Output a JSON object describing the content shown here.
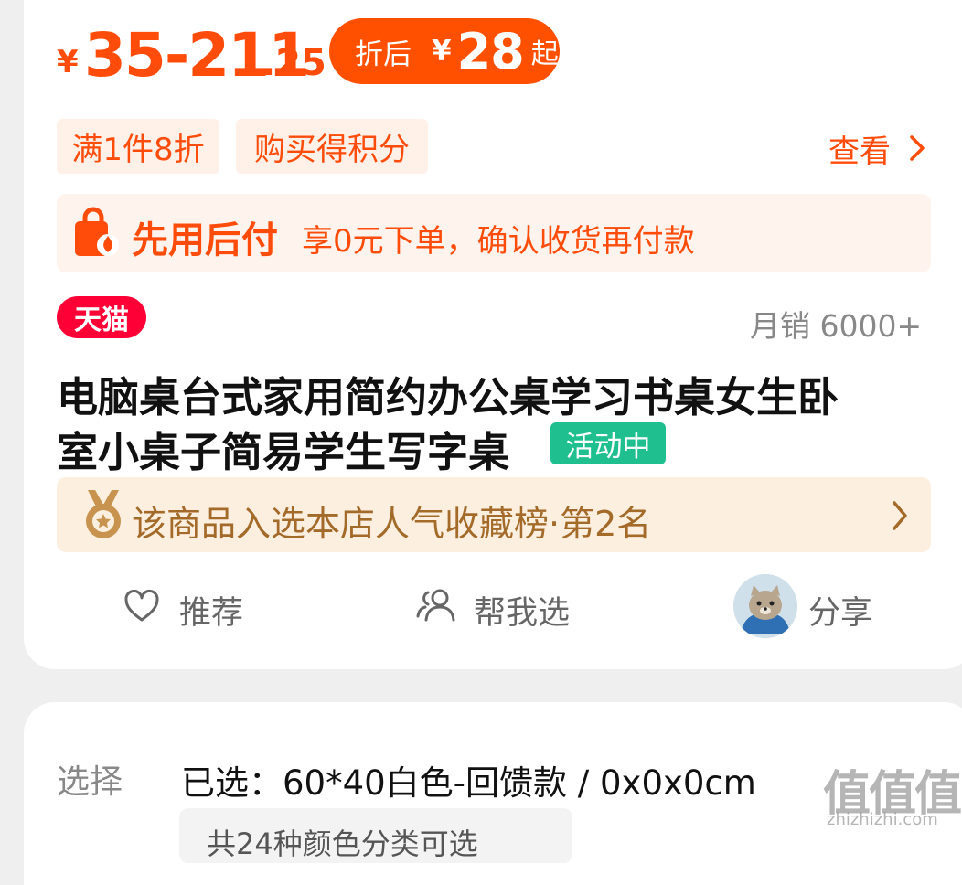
{
  "price": {
    "currency": "¥",
    "range_main": "35-211",
    "range_decimal": ".25",
    "pill": {
      "label": "折后",
      "currency": "¥",
      "amount": "28",
      "suffix": "起"
    }
  },
  "tags": [
    "满1件8折",
    "购买得积分"
  ],
  "view_more": "查看",
  "pay_later": {
    "title": "先用后付",
    "description": "享0元下单，确认收货再付款"
  },
  "badge": "天猫",
  "sales": "月销 6000+",
  "product": {
    "title_line1": "电脑桌台式家用简约办公桌学习书桌女生卧",
    "title_line2": "室小桌子简易学生写字桌",
    "activity_badge": "活动中"
  },
  "ranking": "该商品入选本店人气收藏榜·第2名",
  "actions": {
    "recommend": "推荐",
    "help_choose": "帮我选",
    "share": "分享"
  },
  "selection": {
    "label": "选择",
    "value": "已选：60*40白色-回馈款 / 0x0x0cm",
    "options_hint": "共24种颜色分类可选"
  },
  "watermark": {
    "main": "值值值",
    "sub": "zhizhizhi.com"
  },
  "colors": {
    "accent": "#ff4c0a",
    "tmall": "#ff0036",
    "activity": "#1fbf8f",
    "ranking_text": "#a46a2a"
  },
  "icons": [
    "shopping-bag-icon",
    "chevron-right-icon",
    "medal-icon",
    "heart-icon",
    "users-icon",
    "avatar"
  ]
}
